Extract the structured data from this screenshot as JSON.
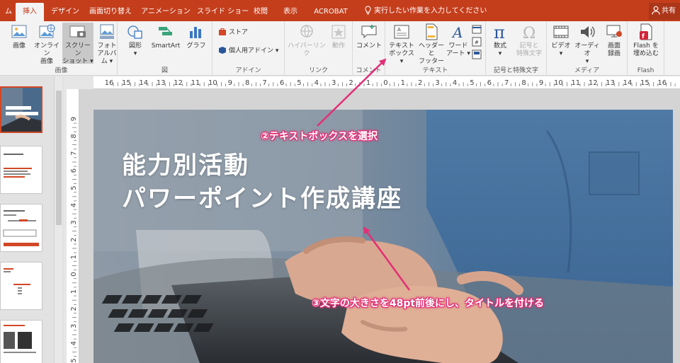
{
  "tabs": {
    "file_partial": "ム",
    "insert": "挿入",
    "design": "デザイン",
    "transitions": "画面切り替え",
    "animations": "アニメーション",
    "slideshow": "スライド ショー",
    "review": "校閲",
    "view": "表示",
    "acrobat": "ACROBAT",
    "tell_me": "実行したい作業を入力してください",
    "share": "共有"
  },
  "ribbon": {
    "images": {
      "label": "画像",
      "picture": "画像",
      "online_1": "オンライン",
      "online_2": "画像",
      "screenshot_1": "スクリーン",
      "screenshot_2": "ショット",
      "album_1": "フォト",
      "album_2": "アルバム"
    },
    "illustrations": {
      "label": "図",
      "shapes": "図形",
      "smartart": "SmartArt",
      "chart": "グラフ"
    },
    "addins": {
      "label": "アドイン",
      "store": "ストア",
      "my_addins": "個人用アドイン"
    },
    "links": {
      "label": "リンク",
      "hyperlink": "ハイパーリンク",
      "action": "動作"
    },
    "comments": {
      "label": "コメント",
      "comment": "コメント"
    },
    "text": {
      "label": "テキスト",
      "textbox_1": "テキスト",
      "textbox_2": "ボックス",
      "header_1": "ヘッダーと",
      "header_2": "フッター",
      "wordart_1": "ワード",
      "wordart_2": "アート"
    },
    "symbols": {
      "label": "記号と特殊文字",
      "equation": "数式",
      "symbol_1": "記号と",
      "symbol_2": "特殊文字"
    },
    "media": {
      "label": "メディア",
      "video": "ビデオ",
      "audio": "オーディオ",
      "screenrec_1": "画面",
      "screenrec_2": "録画"
    },
    "flash": {
      "label": "Flash",
      "embed_1": "Flash を",
      "embed_2": "埋め込む"
    }
  },
  "slide": {
    "title_line1": "能力別活動",
    "title_line2": "パワーポイント作成講座"
  },
  "annotations": {
    "step2": "②テキストボックスを選択",
    "step3": "③文字の大きさを48pt前後にし、タイトルを付ける"
  },
  "thumbnails": {
    "t1_caption": "",
    "t3_text": "「成長」",
    "t4_text": ""
  },
  "colors": {
    "accent": "#c43e1c",
    "annotation": "#e32e75",
    "thumb_border": "#d24726"
  },
  "ruler_labels": [
    "16",
    "15",
    "14",
    "13",
    "12",
    "11",
    "10",
    "9",
    "8",
    "7",
    "6",
    "5",
    "4",
    "3",
    "2",
    "1",
    "0",
    "1",
    "2",
    "3",
    "4",
    "5",
    "6",
    "7",
    "8",
    "9",
    "10",
    "11",
    "12",
    "13",
    "14",
    "15",
    "16"
  ],
  "vruler_labels": [
    "9",
    "8",
    "7",
    "6",
    "5",
    "4",
    "3",
    "2",
    "1",
    "0",
    "1",
    "2",
    "3",
    "4",
    "5"
  ]
}
